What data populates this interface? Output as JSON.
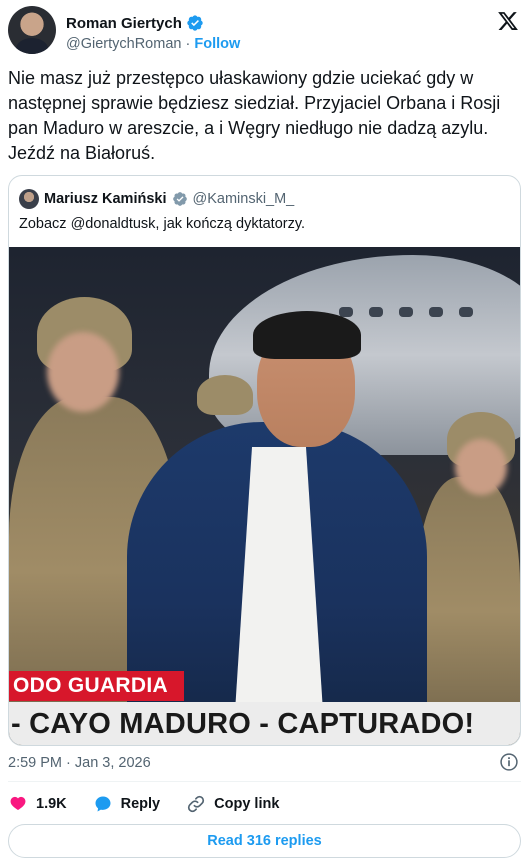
{
  "author": {
    "name": "Roman Giertych",
    "handle": "@GiertychRoman",
    "separator": "·",
    "follow_label": "Follow"
  },
  "tweet_text": "Nie masz już przestępco ułaskawiony gdzie uciekać gdy w następnej sprawie będziesz siedział. Przyjaciel Orbana i Rosji pan Maduro w areszcie, a i Węgry niedługo nie dadzą azylu. Jeźdź na Białoruś.",
  "quoted": {
    "name": "Mariusz Kamiński",
    "handle": "@Kaminski_M_",
    "text": "Zobacz @donaldtusk, jak kończą dyktatorzy.",
    "media": {
      "banner_top": "ODO GUARDIA",
      "banner_bottom": "- CAYO MADURO - CAPTURADO!"
    }
  },
  "timestamp": "2:59 PM · Jan 3, 2026",
  "actions": {
    "likes": "1.9K",
    "reply_label": "Reply",
    "copy_link_label": "Copy link"
  },
  "read_replies_label": "Read 316 replies",
  "colors": {
    "accent": "#1d9bf0",
    "like": "#f91880",
    "banner_red": "#d7172b",
    "muted": "#536471"
  },
  "icons": [
    "verified-badge-icon",
    "x-logo-icon",
    "info-icon",
    "heart-icon",
    "reply-bubble-icon",
    "link-icon"
  ]
}
